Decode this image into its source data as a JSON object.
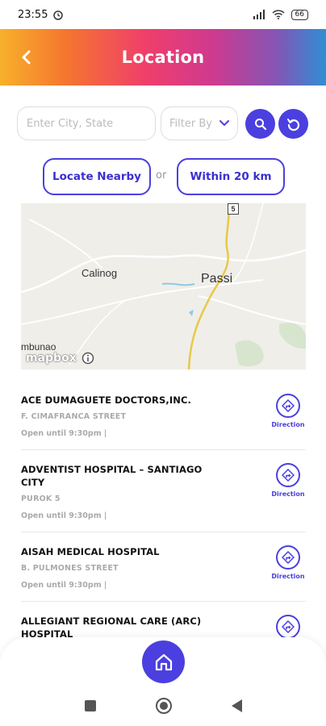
{
  "status": {
    "time": "23:55",
    "battery": "66"
  },
  "header": {
    "title": "Location"
  },
  "search": {
    "placeholder": "Enter City, State",
    "filter_label": "Filter By"
  },
  "chips": {
    "nearby": "Locate Nearby",
    "or": "or",
    "radius": "Within 20 km"
  },
  "map": {
    "labels": {
      "calinog": "Calinog",
      "passi": "Passi",
      "mbunao": "mbunao",
      "road_shield": "5"
    },
    "attribution": "mapbox"
  },
  "results": [
    {
      "name": "ACE DUMAGUETE DOCTORS,INC.",
      "street": "F. CIMAFRANCA STREET",
      "hours": "Open until 9:30pm |",
      "direction_label": "Direction"
    },
    {
      "name": "ADVENTIST HOSPITAL – SANTIAGO CITY",
      "street": "PUROK 5",
      "hours": "Open until 9:30pm |",
      "direction_label": "Direction"
    },
    {
      "name": "AISAH MEDICAL HOSPITAL",
      "street": "B. PULMONES STREET",
      "hours": "Open until 9:30pm |",
      "direction_label": "Direction"
    },
    {
      "name": "ALLEGIANT REGIONAL CARE (ARC) HOSPITAL",
      "street": "",
      "hours": "",
      "direction_label": ""
    }
  ],
  "colors": {
    "accent": "#4b3fe0"
  },
  "icons": {
    "back": "chevron-left-icon",
    "search": "search-icon",
    "reset": "refresh-icon",
    "direction": "direction-arrow-icon",
    "home": "home-icon"
  }
}
